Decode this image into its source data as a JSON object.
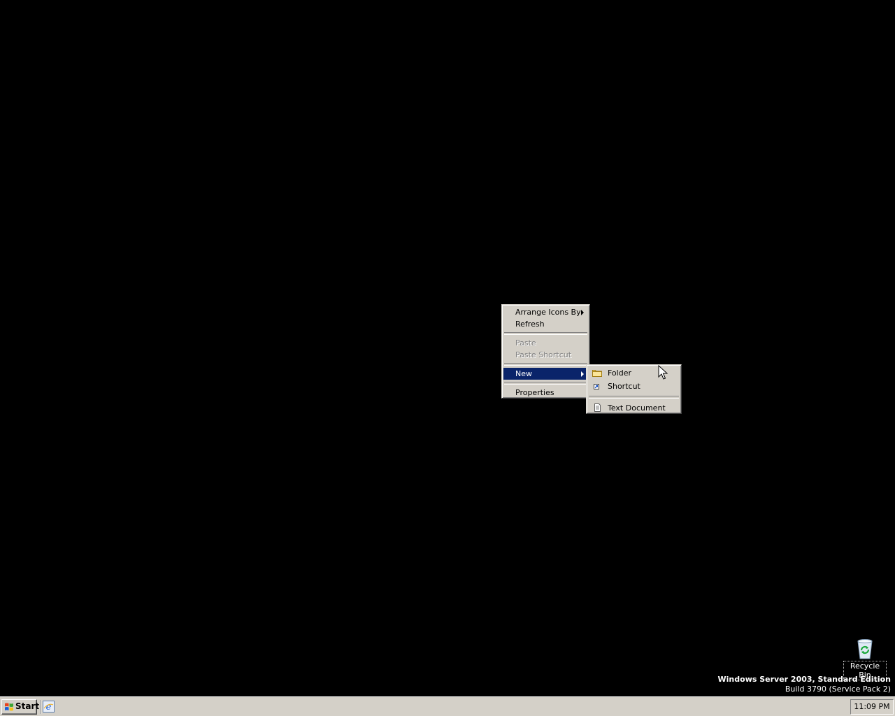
{
  "context_menu": {
    "arrange_icons_by": "Arrange Icons By",
    "refresh": "Refresh",
    "paste": "Paste",
    "paste_shortcut": "Paste Shortcut",
    "new": "New",
    "properties": "Properties"
  },
  "new_submenu": {
    "folder": "Folder",
    "shortcut": "Shortcut",
    "text_document": "Text Document"
  },
  "desktop": {
    "recycle_bin_label": "Recycle Bin",
    "version_line1": "Windows Server 2003, Standard Edition",
    "version_line2": "Build 3790 (Service Pack 2)"
  },
  "taskbar": {
    "start_label": "Start",
    "clock": "11:09 PM"
  },
  "colors": {
    "desktop_bg": "#000000",
    "menu_bg": "#d4d0c8",
    "selection": "#0a246a"
  }
}
